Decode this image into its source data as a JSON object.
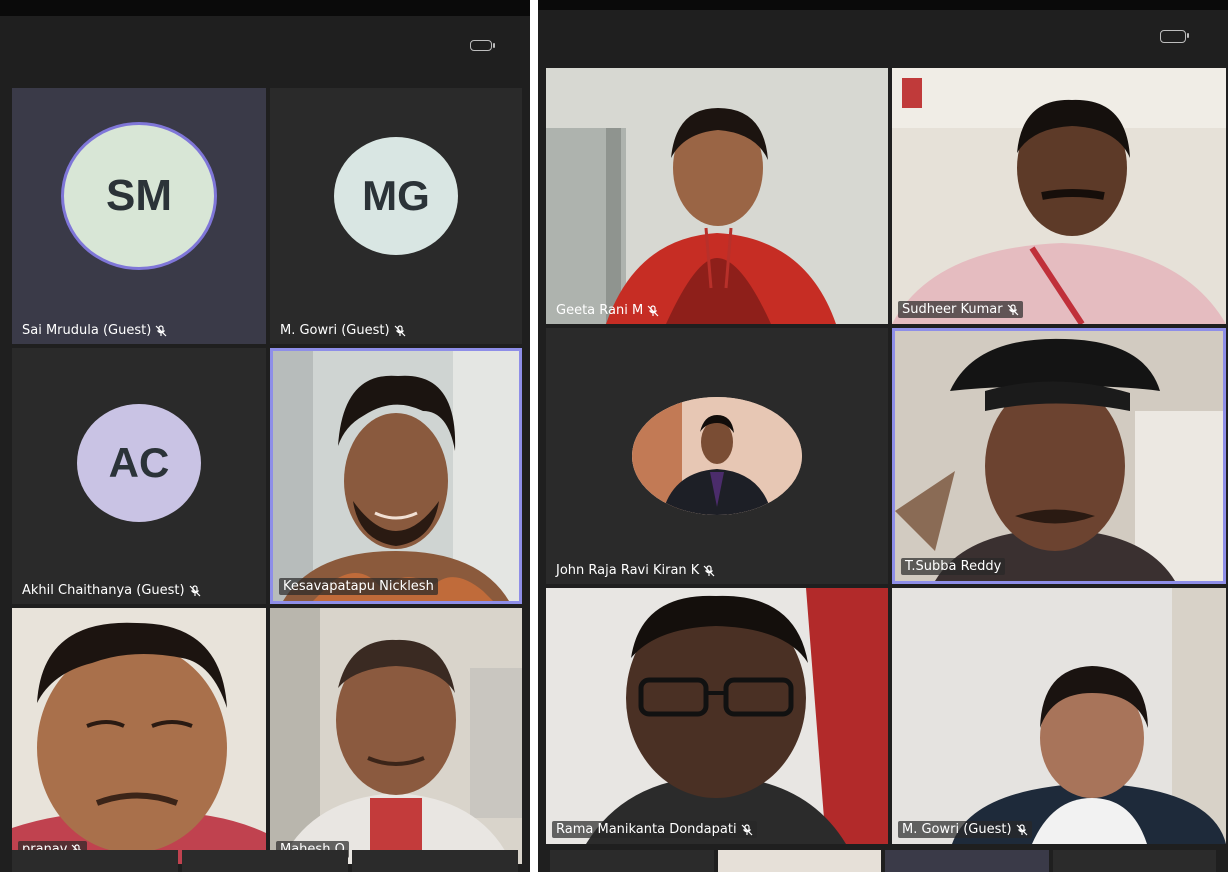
{
  "left_call": {
    "participants": [
      {
        "initials": "SM",
        "name": "Sai Mrudula (Guest)",
        "muted": true
      },
      {
        "initials": "MG",
        "name": "M. Gowri (Guest)",
        "muted": true
      },
      {
        "initials": "AC",
        "name": "Akhil Chaithanya (Guest)",
        "muted": true
      },
      {
        "initials": "",
        "name": "Kesavapatapu Nicklesh",
        "muted": false
      },
      {
        "initials": "",
        "name": "pranav",
        "muted": true
      },
      {
        "initials": "",
        "name": "Mahesh O",
        "muted": false
      }
    ]
  },
  "right_call": {
    "participants": [
      {
        "name": "Geeta Rani M",
        "muted": true
      },
      {
        "name": "Sudheer Kumar",
        "muted": true
      },
      {
        "name": "John Raja Ravi Kiran K",
        "muted": true
      },
      {
        "name": "T.Subba Reddy",
        "muted": false
      },
      {
        "name": "Rama Manikanta Dondapati",
        "muted": true
      },
      {
        "name": "M. Gowri (Guest)",
        "muted": true
      }
    ]
  },
  "colors": {
    "background": "#1f1f1f",
    "tile": "#2a2a2a",
    "active_border": "#8e8ee8"
  }
}
